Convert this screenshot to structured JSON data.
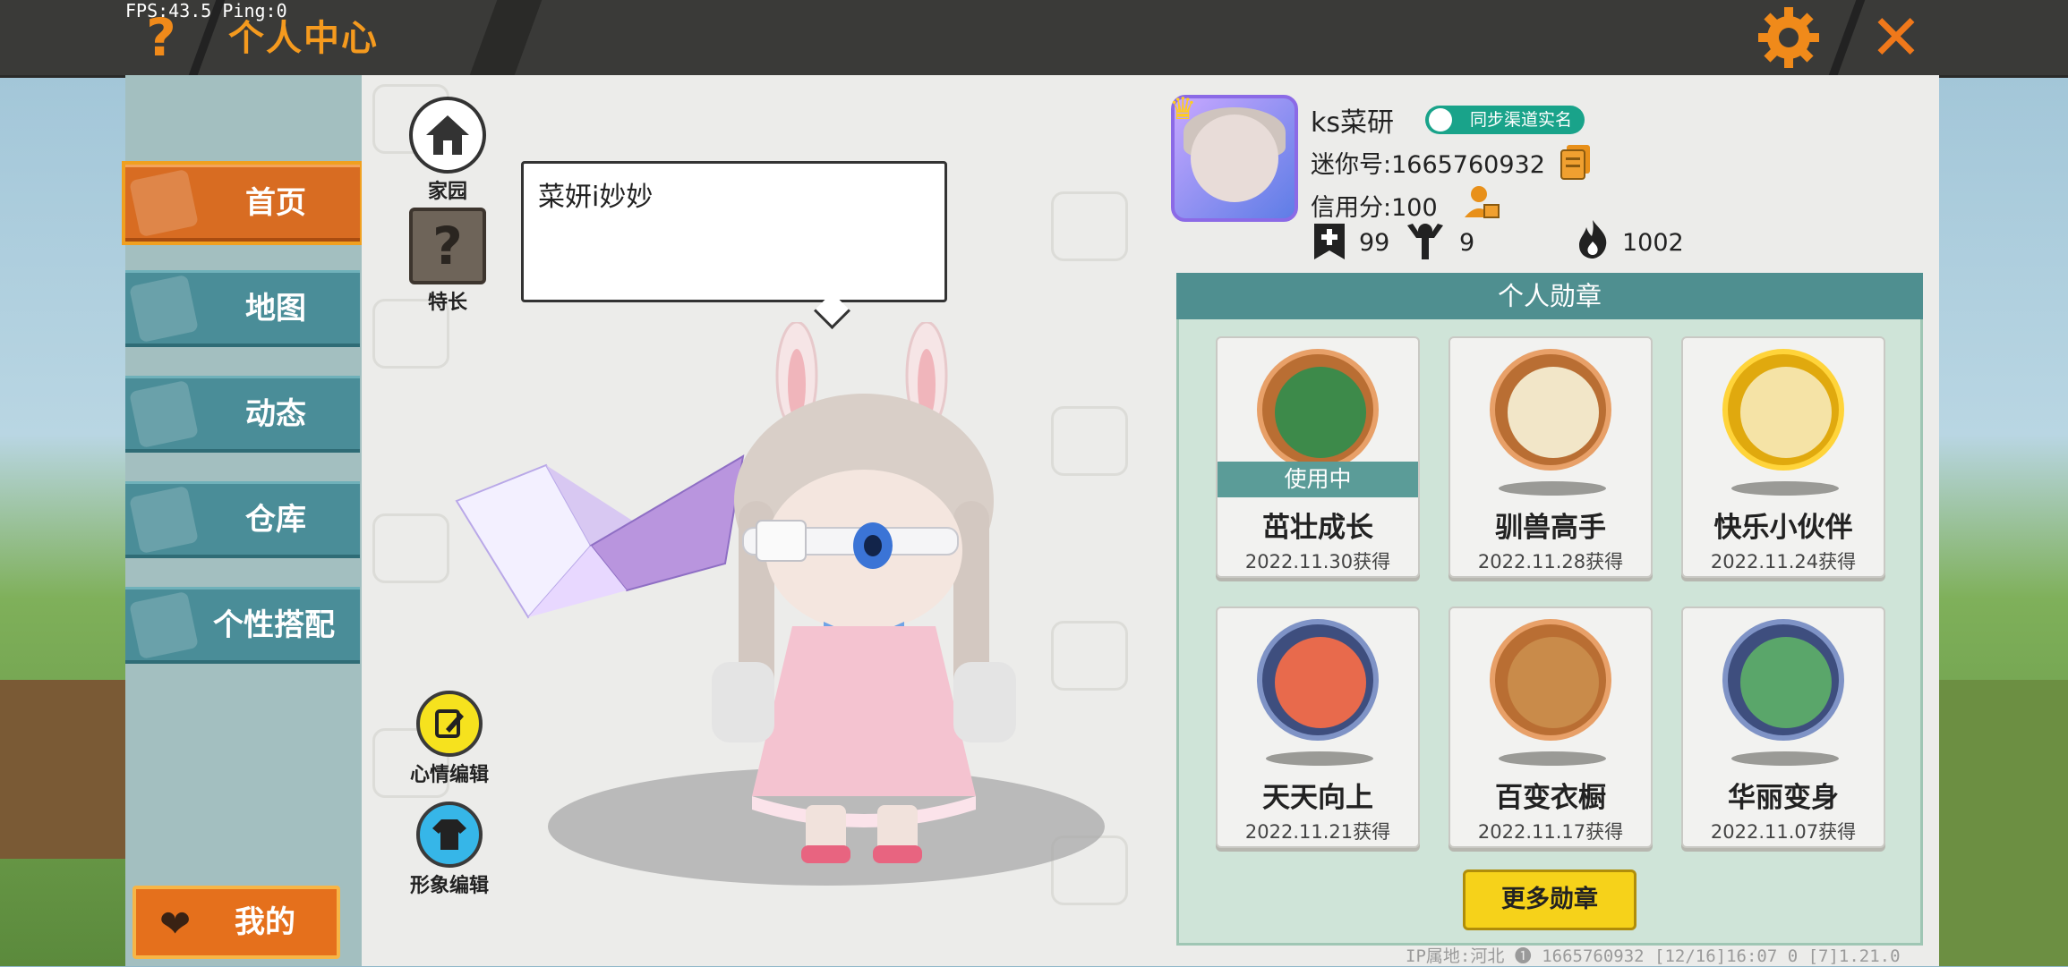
{
  "debug": {
    "fps": "FPS:43.5  Ping:0"
  },
  "header": {
    "title": "个人中心",
    "help_icon": "question-mark-icon",
    "settings_icon": "gear-icon",
    "close_icon": "close-x-icon"
  },
  "colors": {
    "accent_orange": "#f08a1a",
    "panel_teal": "#4a8d98",
    "active_orange": "#d86c22",
    "button_yellow": "#f6d21a"
  },
  "nav": {
    "items": [
      {
        "label": "首页",
        "active": true
      },
      {
        "label": "地图",
        "active": false
      },
      {
        "label": "动态",
        "active": false
      },
      {
        "label": "仓库",
        "active": false
      },
      {
        "label": "个性搭配",
        "active": false
      }
    ],
    "mine_label": "我的"
  },
  "center": {
    "home_label": "家园",
    "talent_label": "特长",
    "speech": "菜妍i妙妙",
    "mood_edit_label": "心情编辑",
    "look_edit_label": "形象编辑"
  },
  "profile": {
    "name": "ks菜研",
    "realname_badge": "同步渠道实名",
    "mini_id": "迷你号:1665760932",
    "credit": "信用分:100",
    "stats": {
      "friends": "99",
      "fans": "9",
      "heat": "1002"
    }
  },
  "medals": {
    "header": "个人勋章",
    "in_use_label": "使用中",
    "items": [
      {
        "name": "茁壮成长",
        "date": "2022.11.30获得"
      },
      {
        "name": "驯兽高手",
        "date": "2022.11.28获得"
      },
      {
        "name": "快乐小伙伴",
        "date": "2022.11.24获得"
      },
      {
        "name": "天天向上",
        "date": "2022.11.21获得"
      },
      {
        "name": "百变衣橱",
        "date": "2022.11.17获得"
      },
      {
        "name": "华丽变身",
        "date": "2022.11.07获得"
      }
    ],
    "more_label": "更多勋章"
  },
  "footer": {
    "text": "IP属地:河北 ❶      1665760932   [12/16]16:07 0   [7]1.21.0"
  }
}
